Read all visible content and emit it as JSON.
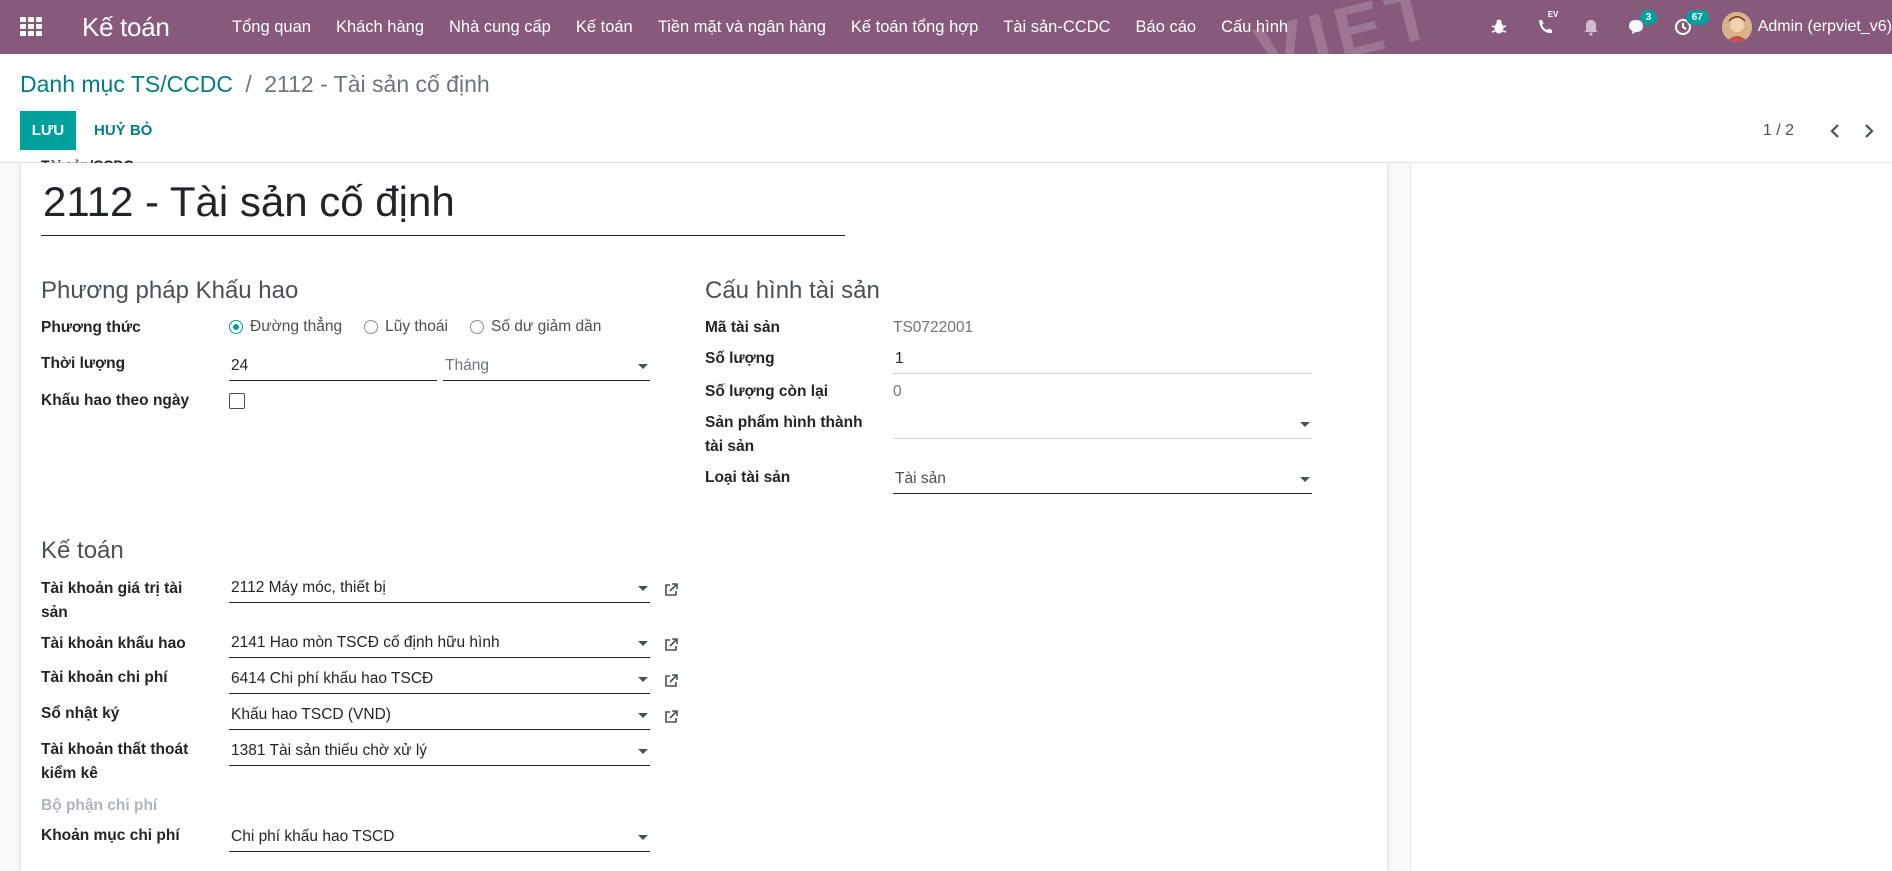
{
  "navbar": {
    "brand": "Kế toán",
    "watermark": "VIET",
    "menu": [
      "Tổng quan",
      "Khách hàng",
      "Nhà cung cấp",
      "Kế toán",
      "Tiền mặt và ngân hàng",
      "Kế toán tổng hợp",
      "Tài sản-CCDC",
      "Báo cáo",
      "Cấu hình"
    ],
    "phone_label": "EV",
    "messages_count": "3",
    "activities_count": "67",
    "user_name": "Admin (erpviet_v6)"
  },
  "breadcrumb": {
    "parent": "Danh mục TS/CCDC",
    "separator": "/",
    "current": "2112 - Tài sản cố định"
  },
  "actions": {
    "save": "LƯU",
    "cancel": "HUỶ BỎ"
  },
  "pager": {
    "value": "1 / 2"
  },
  "form": {
    "name_label": "Tài sản/CCDC",
    "name": "2112 - Tài sản cố định",
    "depreciation": {
      "title": "Phương pháp Khấu hao",
      "method_label": "Phương thức",
      "methods": [
        "Đường thẳng",
        "Lũy thoái",
        "Số dư giảm dần"
      ],
      "selected_method": "Đường thẳng",
      "duration_label": "Thời lượng",
      "duration_value": "24",
      "duration_unit": "Tháng",
      "daily_label": "Khấu hao theo ngày",
      "daily_checked": false
    },
    "asset_config": {
      "title": "Cấu hình tài sản",
      "code_label": "Mã tài sản",
      "code_value": "TS0722001",
      "qty_label": "Số lượng",
      "qty_value": "1",
      "remaining_label": "Số lượng còn lại",
      "remaining_value": "0",
      "product_label": "Sản phẩm hình thành tài sản",
      "product_value": "",
      "type_label": "Loại tài sản",
      "type_value": "Tài sản"
    },
    "accounting": {
      "title": "Kế toán",
      "value_account_label": "Tài khoản giá trị tài sản",
      "value_account": "2112 Máy móc, thiết bị",
      "dep_account_label": "Tài khoản khấu hao",
      "dep_account": "2141 Hao mòn TSCĐ cố định hữu hình",
      "expense_account_label": "Tài khoản chi phí",
      "expense_account": "6414 Chi phí khấu hao TSCĐ",
      "journal_label": "Sổ nhật ký",
      "journal": "Khấu hao TSCD (VND)",
      "loss_account_label": "Tài khoản thất thoát kiểm kê",
      "loss_account": "1381 Tài sản thiếu chờ xử lý",
      "cost_center_label": "Bộ phận chi phí",
      "expense_item_label": "Khoản mục chi phí",
      "expense_item": "Chi phí khấu hao TSCD"
    }
  },
  "colors": {
    "navbar": "#875a7b",
    "primary": "#00a09d",
    "link": "#017e84"
  }
}
